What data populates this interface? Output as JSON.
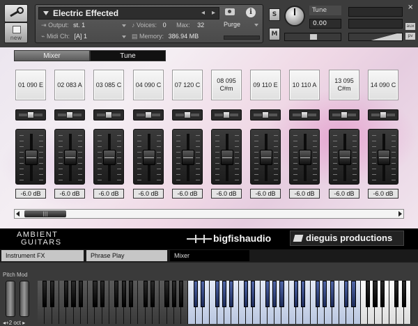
{
  "header": {
    "instrument_name": "Electric Effected",
    "output_label": "Output:",
    "output_value": "st. 1",
    "midi_label": "Midi Ch:",
    "midi_value": "[A]  1",
    "voices_label": "Voices:",
    "voices_value": "0",
    "max_label": "Max:",
    "max_value": "32",
    "memory_label": "Memory:",
    "memory_value": "386.94 MB",
    "purge_label": "Purge",
    "new_label": "new",
    "s_label": "S",
    "m_label": "M",
    "tune_label": "Tune",
    "tune_value": "0.00",
    "aux_label": "aux",
    "pv_label": "pv",
    "close_icon": "×"
  },
  "mixer": {
    "tabs": [
      {
        "label": "Mixer",
        "active": true
      },
      {
        "label": "Tune",
        "active": false
      }
    ],
    "channels": [
      {
        "name": "01 090 E",
        "db": "-6.0 dB"
      },
      {
        "name": "02 083 A",
        "db": "-6.0 dB"
      },
      {
        "name": "03 085 C",
        "db": "-6.0 dB"
      },
      {
        "name": "04 090 C",
        "db": "-6.0 dB"
      },
      {
        "name": "07 120 C",
        "db": "-6.0 dB"
      },
      {
        "name": "08 095 C#m",
        "db": "-6.0 dB"
      },
      {
        "name": "09 110 E",
        "db": "-6.0 dB"
      },
      {
        "name": "10 110 A",
        "db": "-6.0 dB"
      },
      {
        "name": "13 095 C#m",
        "db": "-6.0 dB"
      },
      {
        "name": "14 090 C",
        "db": "-6.0 dB"
      }
    ],
    "scroll_thumb_label": "|||"
  },
  "branding": {
    "product_line1": "AMBIENT",
    "product_line2": "GUITARS",
    "publisher": "bigfishaudio",
    "developer": "dieguis productions"
  },
  "bottom_tabs": [
    {
      "label": "Instrument FX"
    },
    {
      "label": "Phrase Play"
    },
    {
      "label": "Mixer"
    }
  ],
  "keyboard": {
    "pitch_mod_label": "Pitch Mod",
    "octave_label": "◂+2 oct ▸"
  },
  "colors": {
    "accent_key": "#5066a8",
    "panel_bg": "#3c3c3c"
  }
}
